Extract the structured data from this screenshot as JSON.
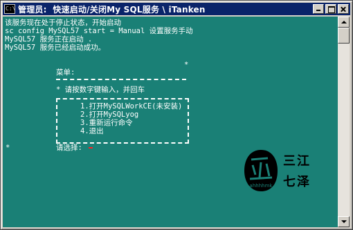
{
  "window": {
    "title": "管理员:  快速启动/关闭My SQL服务 \\ iTanken",
    "icon": "console-window-icon",
    "icon_text": "C:\\",
    "controls": [
      "minimize-icon",
      "maximize-icon",
      "close-icon"
    ]
  },
  "console": {
    "background": "#1a8076",
    "foreground": "#ffffff",
    "lines": [
      "该服务现在处于停止状态，开始启动",
      "sc config MySQL57 start = Manual 设置服务手动",
      "MySQL57 服务正在启动 .",
      "MySQL57 服务已经启动成功。"
    ],
    "star_top": "*",
    "menu_title": "菜单:",
    "hint": "* 请按数字键输入，并回车",
    "options": [
      "1.打开MySQLWorkCE(未安装)",
      "2.打开MySQLyog",
      "3.重新运行命令",
      "4.退出"
    ],
    "star_left": "*",
    "prompt": "请选择:",
    "cursor_color": "#ff2020"
  },
  "watermark": {
    "seal_text": "ahhhhmk",
    "text_line1": "三江",
    "text_line2": "七泽"
  }
}
